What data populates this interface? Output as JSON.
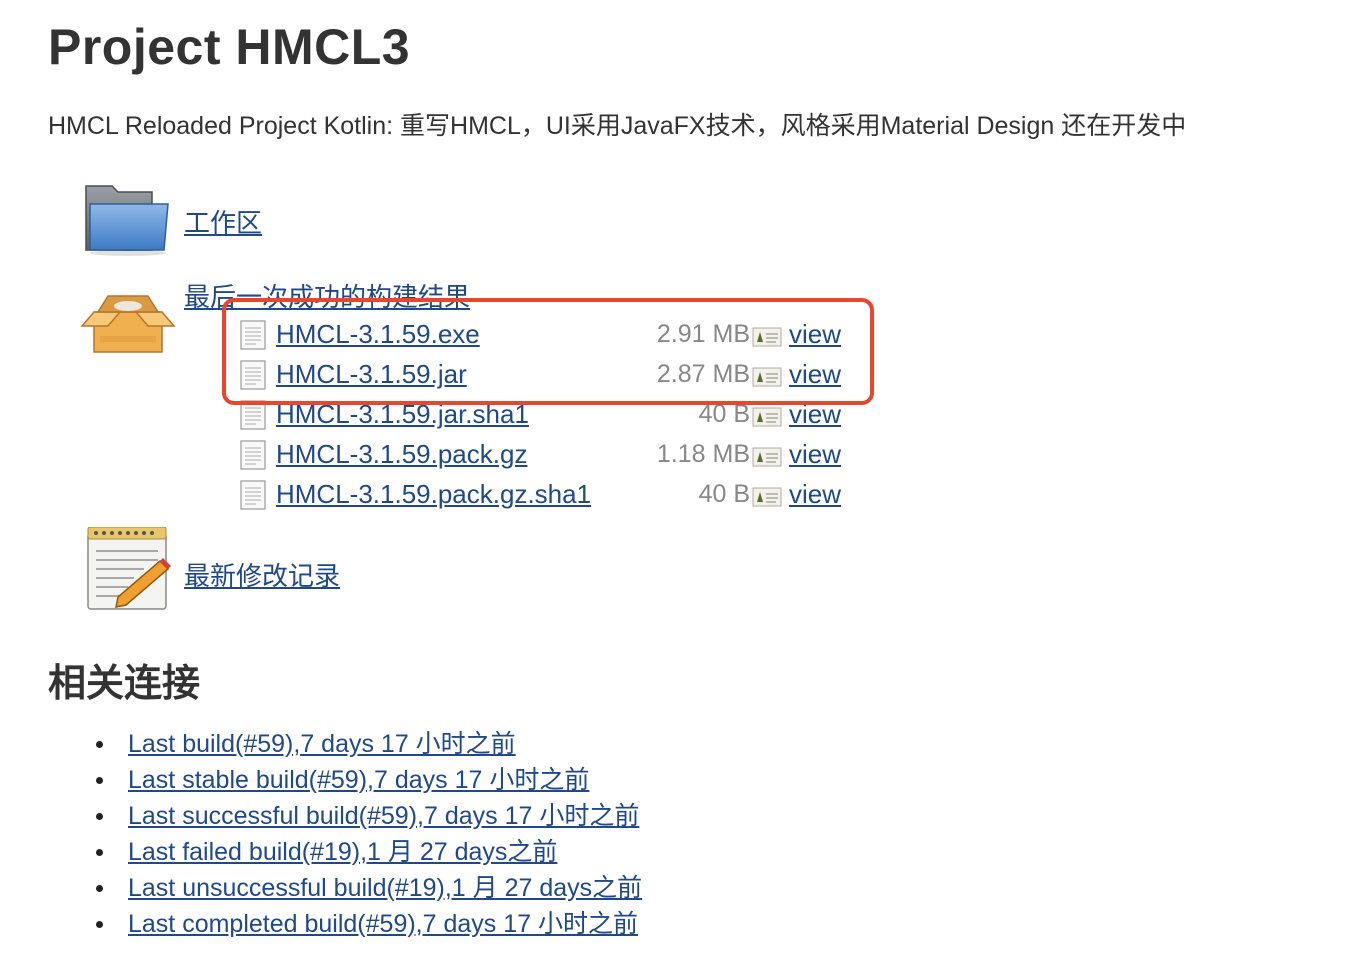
{
  "page": {
    "title": "Project HMCL3",
    "description": "HMCL Reloaded Project Kotlin: 重写HMCL，UI采用JavaFX技术，风格采用Material Design 还在开发中"
  },
  "workspace": {
    "label": "工作区",
    "icon": "folder-icon"
  },
  "last_successful_artifacts": {
    "label": "最后一次成功的构建结果",
    "icon": "package-box-icon",
    "files": [
      {
        "name": "HMCL-3.1.59.exe",
        "size": "2.91 MB",
        "view_label": "view"
      },
      {
        "name": "HMCL-3.1.59.jar",
        "size": "2.87 MB",
        "view_label": "view"
      },
      {
        "name": "HMCL-3.1.59.jar.sha1",
        "size": "40 B",
        "view_label": "view"
      },
      {
        "name": "HMCL-3.1.59.pack.gz",
        "size": "1.18 MB",
        "view_label": "view"
      },
      {
        "name": "HMCL-3.1.59.pack.gz.sha1",
        "size": "40 B",
        "view_label": "view"
      }
    ]
  },
  "recent_changes": {
    "label": "最新修改记录",
    "icon": "notepad-pencil-icon"
  },
  "highlight_color": "#e8462d",
  "link_color": "#204a87",
  "related_links": {
    "heading": "相关连接",
    "items": [
      "Last build(#59),7 days 17 小时之前",
      "Last stable build(#59),7 days 17 小时之前",
      "Last successful build(#59),7 days 17 小时之前",
      "Last failed build(#19),1 月 27 days之前",
      "Last unsuccessful build(#19),1 月 27 days之前",
      "Last completed build(#59),7 days 17 小时之前"
    ]
  }
}
